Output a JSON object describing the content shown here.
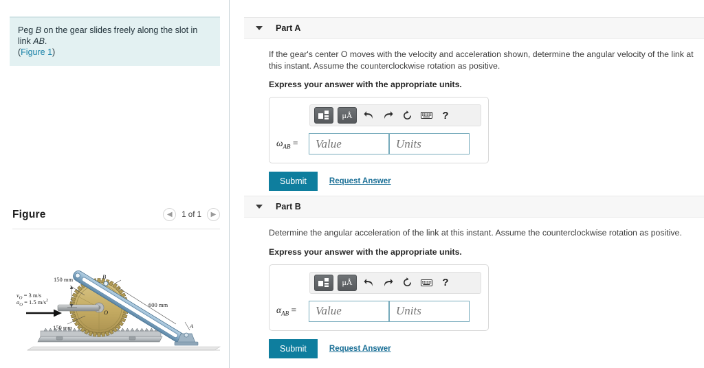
{
  "problem": {
    "text_before": "Peg ",
    "em1": "B",
    "text_mid": " on the gear slides freely along the slot in link ",
    "em2": "AB",
    "text_after": ".",
    "figure_ref_open": "(",
    "figure_ref": "Figure 1",
    "figure_ref_close": ")"
  },
  "figure_panel": {
    "title": "Figure",
    "prev_icon": "chevron-left-icon",
    "next_icon": "chevron-right-icon",
    "counter": "1 of 1",
    "diagram": {
      "labels": {
        "top_dim": "150 mm",
        "bottom_dim": "150 mm",
        "link_length": "600 mm",
        "velocity": "v",
        "velocity_sub": "O",
        "velocity_val": " = 3 m/s",
        "accel": "a",
        "accel_sub": "O",
        "accel_val": " = 1.5 m/s",
        "accel_exp": "2",
        "point_b": "B",
        "point_o": "O",
        "point_a": "A"
      },
      "colors": {
        "gear_fill": "#c9b16a",
        "gear_teeth": "#8d7b45",
        "link_fill": "#8fb3cc",
        "link_edge": "#4f7b9c",
        "rack_fill": "#b9bdc0",
        "ground": "#d8d8d8"
      }
    }
  },
  "parts": [
    {
      "id": "part-a",
      "caret_icon": "caret-down-icon",
      "label": "Part A",
      "question": "If the gear's center O moves with the velocity and acceleration shown, determine the angular velocity of the link at this instant. Assume the counterclockwise rotation as positive.",
      "instruction": "Express your answer with the appropriate units.",
      "toolbar": {
        "template_icon": "math-template-icon",
        "units_icon": "mu-angstrom-icon",
        "units_label": "μÅ",
        "undo_icon": "undo-icon",
        "redo_icon": "redo-icon",
        "reset_icon": "reset-icon",
        "keyboard_icon": "keyboard-icon",
        "help_icon": "help-icon",
        "help_label": "?"
      },
      "answer": {
        "symbol": "ω",
        "symbol_sub": "AB",
        "equals": " =",
        "value_placeholder": "Value",
        "units_placeholder": "Units",
        "value": "",
        "units": ""
      },
      "submit_label": "Submit",
      "request_label": "Request Answer"
    },
    {
      "id": "part-b",
      "caret_icon": "caret-down-icon",
      "label": "Part B",
      "question": "Determine the angular acceleration of the link at this instant. Assume the counterclockwise rotation as positive.",
      "instruction": "Express your answer with the appropriate units.",
      "toolbar": {
        "template_icon": "math-template-icon",
        "units_icon": "mu-angstrom-icon",
        "units_label": "μÅ",
        "undo_icon": "undo-icon",
        "redo_icon": "redo-icon",
        "reset_icon": "reset-icon",
        "keyboard_icon": "keyboard-icon",
        "help_icon": "help-icon",
        "help_label": "?"
      },
      "answer": {
        "symbol": "α",
        "symbol_sub": "AB",
        "equals": " =",
        "value_placeholder": "Value",
        "units_placeholder": "Units",
        "value": "",
        "units": ""
      },
      "submit_label": "Submit",
      "request_label": "Request Answer"
    }
  ],
  "theme": {
    "problem_bg": "#e3f1f2",
    "link_color": "#1a82a8",
    "submit_bg": "#0e7e9e",
    "field_border": "#76aabb"
  }
}
